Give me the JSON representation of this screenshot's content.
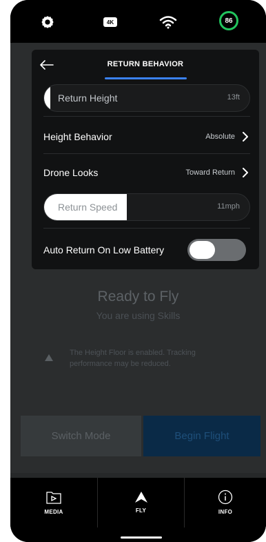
{
  "status_bar": {
    "icons": [
      "gear-icon",
      "4k-icon",
      "wifi-icon"
    ],
    "four_k": "4K",
    "battery": "86"
  },
  "modal": {
    "title": "RETURN BEHAVIOR",
    "return_height": {
      "label": "Return Height",
      "value": "13ft",
      "fill": 0.03
    },
    "height_behavior": {
      "label": "Height Behavior",
      "value": "Absolute"
    },
    "drone_looks": {
      "label": "Drone Looks",
      "value": "Toward Return"
    },
    "return_speed": {
      "label": "Return Speed",
      "value": "11mph",
      "fill": 0.4
    },
    "auto_return": {
      "label": "Auto Return On Low Battery",
      "enabled": false
    }
  },
  "background": {
    "title": "Ready to Fly",
    "subtitle": "You are using Skills",
    "warning": "The Height Floor is enabled. Tracking performance may be reduced.",
    "switch_mode": "Switch Mode",
    "begin_flight": "Begin Flight"
  },
  "nav": {
    "media": "MEDIA",
    "fly": "FLY",
    "info": "INFO"
  },
  "colors": {
    "accent_blue": "#3b82f6",
    "battery_green": "#22c55e"
  }
}
